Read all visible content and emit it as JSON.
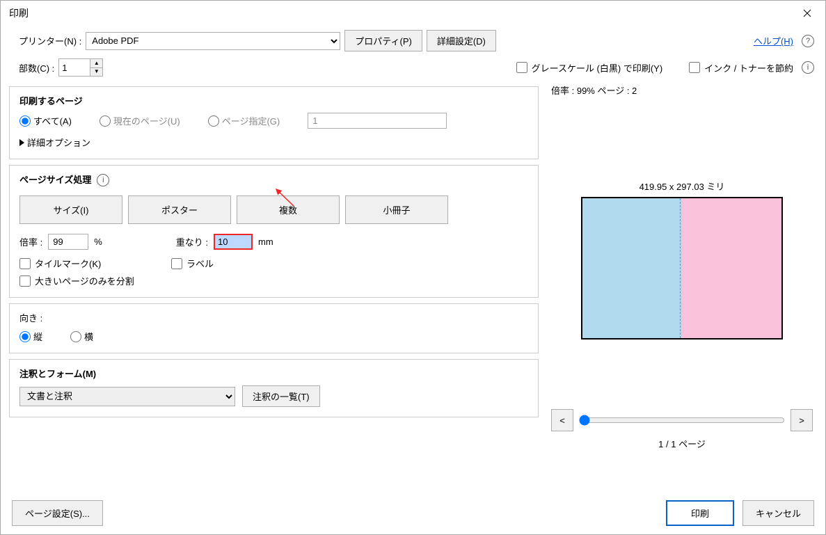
{
  "title": "印刷",
  "printer": {
    "label": "プリンター(N) :",
    "value": "Adobe PDF",
    "properties_btn": "プロパティ(P)",
    "advanced_btn": "詳細設定(D)",
    "help_link": "ヘルプ(H)"
  },
  "copies": {
    "label": "部数(C) :",
    "value": "1"
  },
  "grayscale": "グレースケール (白黒) で印刷(Y)",
  "save_ink": "インク / トナーを節約",
  "pages_to_print": {
    "title": "印刷するページ",
    "all": "すべて(A)",
    "current": "現在のページ(U)",
    "range": "ページ指定(G)",
    "range_value": "1",
    "more": "詳細オプション"
  },
  "page_sizing": {
    "title": "ページサイズ処理",
    "tabs": {
      "size": "サイズ(I)",
      "poster": "ポスター",
      "multiple": "複数",
      "booklet": "小冊子"
    },
    "scale_label": "倍率 :",
    "scale_value": "99",
    "scale_unit": "%",
    "overlap_label": "重なり :",
    "overlap_value": "10",
    "overlap_unit": "mm",
    "tilemarks": "タイルマーク(K)",
    "labels": "ラベル",
    "split_large": "大きいページのみを分割"
  },
  "orientation": {
    "title": "向き :",
    "portrait": "縦",
    "landscape": "横"
  },
  "comments": {
    "title": "注釈とフォーム(M)",
    "value": "文書と注釈",
    "summary_btn": "注釈の一覧(T)"
  },
  "preview": {
    "info": "倍率 : 99% ページ : 2",
    "dimensions": "419.95 x 297.03 ミリ",
    "page_count": "1 / 1 ページ",
    "prev": "<",
    "next": ">"
  },
  "footer": {
    "page_setup": "ページ設定(S)...",
    "print": "印刷",
    "cancel": "キャンセル"
  }
}
